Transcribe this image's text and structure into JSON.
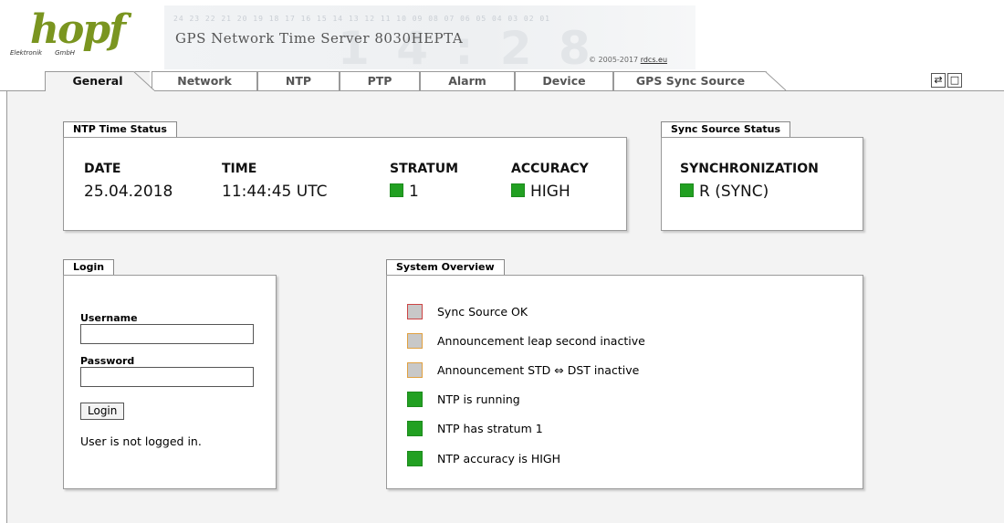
{
  "header": {
    "logo_text": "hopf",
    "logo_sub_left": "Elektronik",
    "logo_sub_right": "GmbH",
    "banner_digits": "24 23 22 21 20 19 18 17 16 15 14 13 12 11 10 09 08 07 06 05 04 03 02 01",
    "banner_ghost": "1 4 : 2 8",
    "product_title": "GPS Network Time Server 8030HEPTA",
    "copyright_prefix": "© 2005-2017 ",
    "copyright_link": "rdcs.eu"
  },
  "tabs": [
    {
      "label": "General",
      "active": true
    },
    {
      "label": "Network",
      "active": false
    },
    {
      "label": "NTP",
      "active": false
    },
    {
      "label": "PTP",
      "active": false
    },
    {
      "label": "Alarm",
      "active": false
    },
    {
      "label": "Device",
      "active": false
    },
    {
      "label": "GPS Sync Source",
      "active": false
    }
  ],
  "window_buttons": {
    "refresh": "⇄",
    "popout": "□"
  },
  "ntp_status": {
    "title": "NTP Time Status",
    "date_label": "DATE",
    "date_value": "25.04.2018",
    "time_label": "TIME",
    "time_value": "11:44:45 UTC",
    "stratum_label": "STRATUM",
    "stratum_value": "1",
    "accuracy_label": "ACCURACY",
    "accuracy_value": "HIGH"
  },
  "sync_status": {
    "title": "Sync Source Status",
    "sync_label": "SYNCHRONIZATION",
    "sync_value": "R (SYNC)"
  },
  "login": {
    "title": "Login",
    "username_label": "Username",
    "password_label": "Password",
    "username_value": "",
    "password_value": "",
    "button_label": "Login",
    "status": "User is not logged in."
  },
  "overview": {
    "title": "System Overview",
    "items": [
      {
        "label": "Sync Source OK",
        "state": "red"
      },
      {
        "label": "Announcement leap second inactive",
        "state": "amber"
      },
      {
        "label": "Announcement STD ⇔ DST inactive",
        "state": "amber"
      },
      {
        "label": "NTP is running",
        "state": "green"
      },
      {
        "label": "NTP has stratum 1",
        "state": "green"
      },
      {
        "label": "NTP accuracy is HIGH",
        "state": "green"
      }
    ]
  },
  "colors": {
    "green": "#22a022",
    "logo_green": "#7a9520",
    "panel_bg": "#f3f3f3"
  }
}
